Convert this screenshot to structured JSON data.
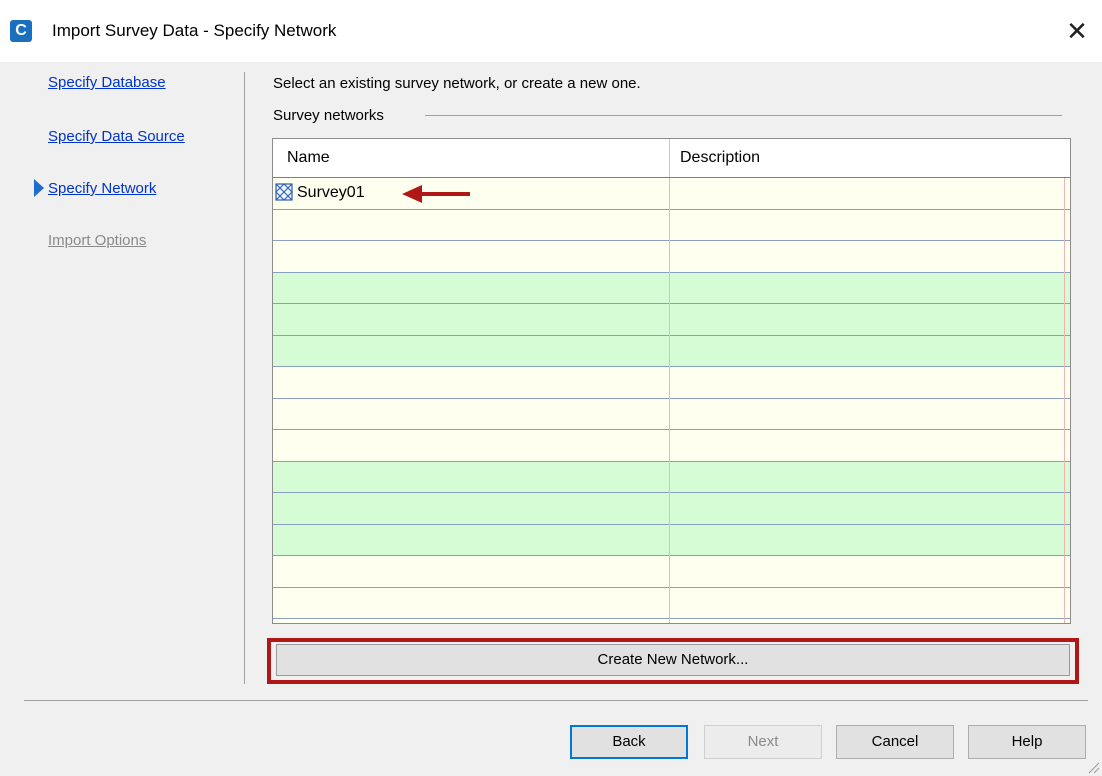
{
  "window": {
    "title": "Import Survey Data - Specify Network",
    "app_icon_letter": "C",
    "close_glyph": "✕"
  },
  "nav": {
    "items": [
      {
        "label": "Specify Database",
        "state": "link"
      },
      {
        "label": "Specify Data Source",
        "state": "link"
      },
      {
        "label": "Specify Network",
        "state": "current"
      },
      {
        "label": "Import Options",
        "state": "disabled"
      }
    ]
  },
  "main": {
    "instruction": "Select an existing survey network, or create a new one.",
    "group_label": "Survey networks",
    "grid": {
      "columns": [
        "Name",
        "Description"
      ],
      "rows": [
        {
          "name": "Survey01",
          "description": "",
          "icon": "survey-network-icon"
        }
      ],
      "row_colors": [
        "#fffff0",
        "#d6fcd6"
      ]
    },
    "create_button": "Create New Network..."
  },
  "footer": {
    "back": "Back",
    "next": "Next",
    "cancel": "Cancel",
    "help": "Help"
  },
  "colors": {
    "accent": "#1e6ccf",
    "annotation": "#b01818",
    "link": "#0033cc"
  }
}
